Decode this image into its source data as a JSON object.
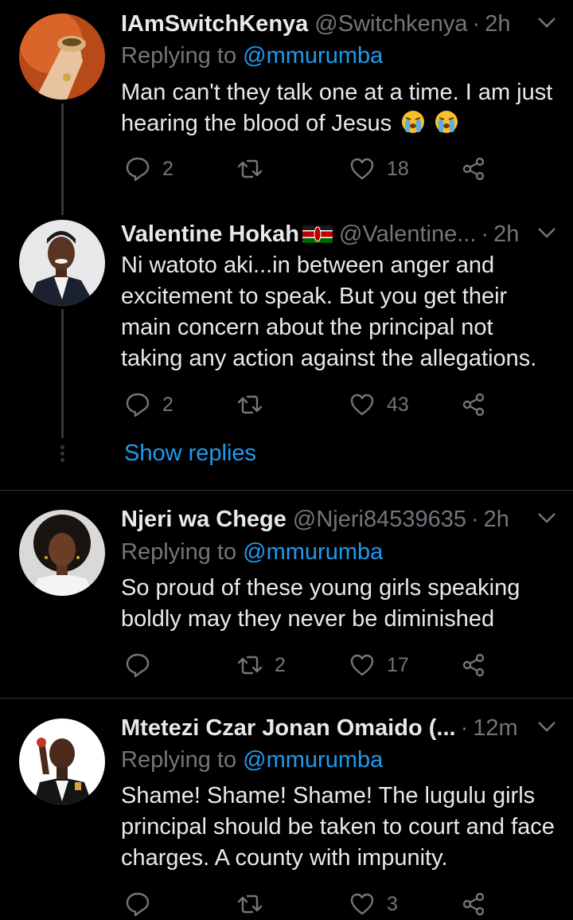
{
  "tweets": [
    {
      "name": "IAmSwitchKenya",
      "handle": "@Switchkenya",
      "time": "2h",
      "replying_prefix": "Replying to",
      "replying_handle": "@mmurumba",
      "body": "Man can't they talk one at a time. I am just hearing the blood of Jesus",
      "replies": "2",
      "retweets": "",
      "likes": "18"
    },
    {
      "name": "Valentine Hokah",
      "handle": "@Valentine...",
      "time": "2h",
      "body": "Ni watoto aki...in between anger and excitement to speak. But you get their main concern about the principal not taking any action against the allegations.",
      "replies": "2",
      "retweets": "",
      "likes": "43",
      "show_replies": "Show replies"
    },
    {
      "name": "Njeri wa Chege",
      "handle": "@Njeri84539635",
      "time": "2h",
      "replying_prefix": "Replying to",
      "replying_handle": "@mmurumba",
      "body": "So proud of these young girls speaking boldly may they never be diminished",
      "replies": "",
      "retweets": "2",
      "likes": "17"
    },
    {
      "name": "Mtetezi Czar Jonan Omaido (...",
      "handle": "",
      "time": "12m",
      "replying_prefix": "Replying to",
      "replying_handle": "@mmurumba",
      "body": "Shame! Shame! Shame! The lugulu girls principal should be taken to court and face charges. A county with impunity.",
      "replies": "",
      "retweets": "",
      "likes": "3"
    }
  ],
  "separator": "·",
  "colors": {
    "background": "#000000",
    "text": "#e7e9ea",
    "muted": "#71767b",
    "link": "#1d9bf0",
    "divider": "#2f3336"
  },
  "icons": [
    "reply-icon",
    "retweet-icon",
    "like-icon",
    "share-icon",
    "chevron-down-icon",
    "loudly-crying-face-emoji",
    "kenya-flag"
  ]
}
